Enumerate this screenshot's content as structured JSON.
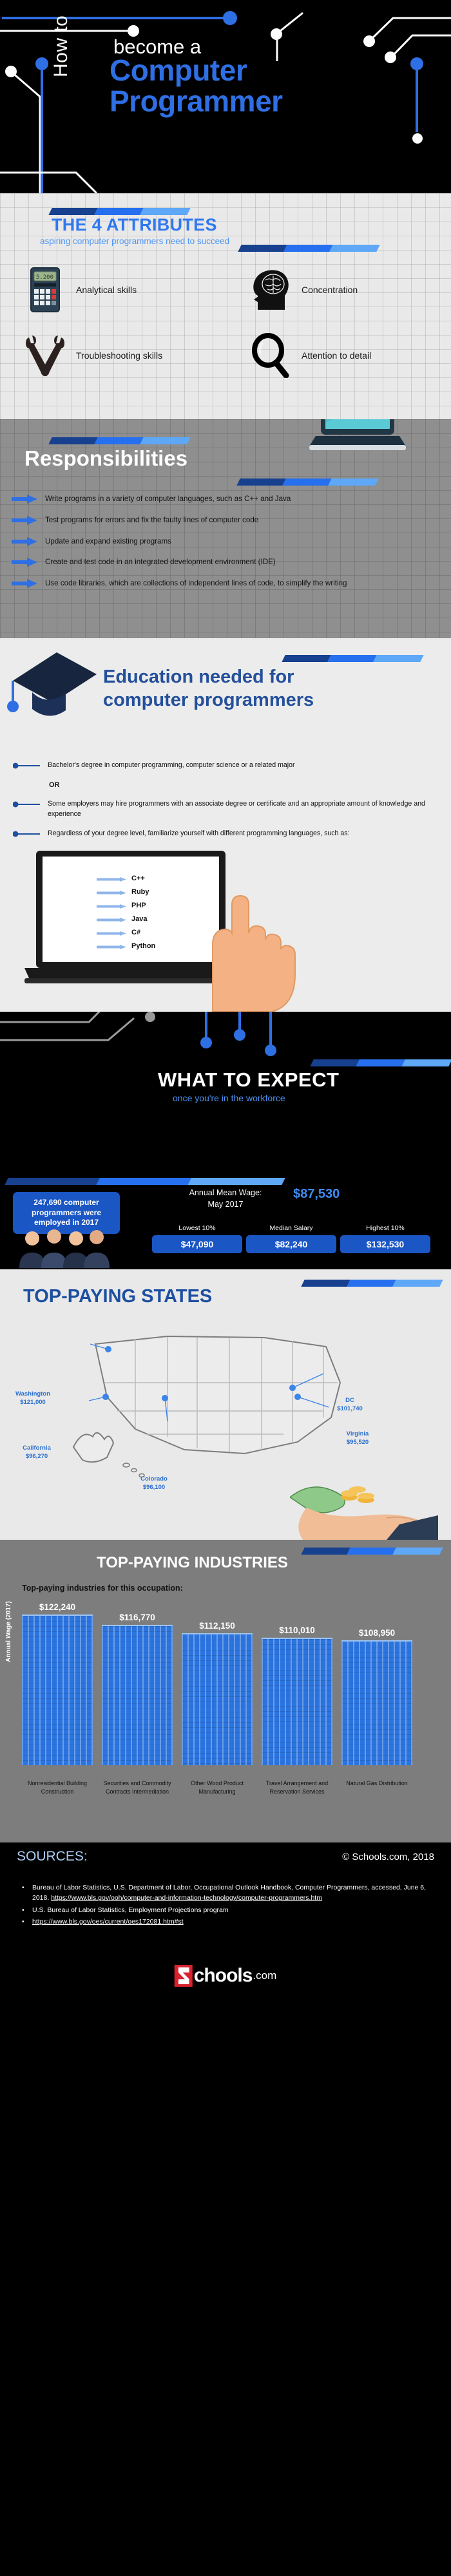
{
  "header": {
    "kicker_vertical": "How to",
    "kicker": "become a",
    "title_line1": "Computer",
    "title_line2": "Programmer"
  },
  "attributes": {
    "heading": "THE 4 ATTRIBUTES",
    "subheading": "aspiring computer programmers need to succeed",
    "items": [
      {
        "icon": "calculator-icon",
        "label": "Analytical skills"
      },
      {
        "icon": "brain-head-icon",
        "label": "Concentration"
      },
      {
        "icon": "crossed-wrenches-icon",
        "label": "Troubleshooting skills"
      },
      {
        "icon": "magnifying-glass-icon",
        "label": "Attention to detail"
      }
    ]
  },
  "responsibilities": {
    "heading": "Responsibilities",
    "items": [
      "Write programs in a variety of computer languages, such as C++ and Java",
      "Test programs for errors and fix the faulty lines of computer code",
      "Update and expand existing programs",
      "Create and test code in an integrated development environment (IDE)",
      "Use code libraries, which are collections of independent lines of code, to simplify the writing"
    ]
  },
  "education": {
    "heading_line1": "Education needed for",
    "heading_line2": "computer programmers",
    "items": [
      "Bachelor's degree in computer programming, computer science or a related major",
      "Some employers may hire programmers with an associate degree or certificate and an appropriate amount of knowledge and experience",
      "Regardless of your degree level, familiarize yourself with different programming languages, such as:"
    ],
    "or_word": "OR",
    "languages": [
      "C++",
      "Ruby",
      "PHP",
      "Java",
      "C#",
      "Python"
    ]
  },
  "what_to_expect": {
    "heading": "WHAT TO EXPECT",
    "subheading": "once you're in the workforce",
    "employment_stat": "247,690 computer programmers were employed in 2017",
    "annual_mean_wage_label": "Annual Mean Wage:",
    "annual_mean_wage_period": "May 2017",
    "annual_mean_wage_value": "$87,530",
    "wage_tiers": [
      {
        "label": "Lowest 10%",
        "value": "$47,090"
      },
      {
        "label": "Median Salary",
        "value": "$82,240"
      },
      {
        "label": "Highest 10%",
        "value": "$132,530"
      }
    ]
  },
  "top_paying_states": {
    "heading": "TOP-PAYING STATES",
    "states": [
      {
        "name": "Washington",
        "value": "$121,000"
      },
      {
        "name": "California",
        "value": "$96,270"
      },
      {
        "name": "Colorado",
        "value": "$96,100"
      },
      {
        "name": "Virginia",
        "value": "$95,520"
      },
      {
        "name": "DC",
        "value": "$101,740"
      }
    ]
  },
  "top_paying_industries": {
    "heading": "TOP-PAYING INDUSTRIES",
    "caption": "Top-paying industries for this occupation:",
    "y_axis_label": "Annual Wage (2017)"
  },
  "chart_data": {
    "type": "bar",
    "title": "TOP-PAYING INDUSTRIES",
    "subtitle": "Top-paying industries for this occupation:",
    "xlabel": "",
    "ylabel": "Annual Wage (2017)",
    "categories": [
      "Nonresidential Building Construction",
      "Securities and Commodity Contracts Intermediation",
      "Other Wood Product Manufacturing",
      "Travel Arrangement and Reservation Services",
      "Natural Gas Distribution"
    ],
    "values": [
      122240,
      116770,
      112150,
      110010,
      108950
    ],
    "value_labels": [
      "$122,240",
      "$116,770",
      "$112,150",
      "$110,010",
      "$108,950"
    ],
    "ylim": [
      0,
      130000
    ],
    "grid": false,
    "legend": "none",
    "bar_color": "#2b74e0"
  },
  "sources": {
    "heading": "SOURCES:",
    "copyright": "© Schools.com, 2018",
    "items": [
      {
        "text": "Bureau of Labor Statistics, U.S. Department of Labor, Occupational Outlook Handbook, Computer Programmers, accessed, June 6, 2018. ",
        "link": "https://www.bls.gov/ooh/computer-and-information-technology/computer-programmers.htm"
      },
      {
        "text": "U.S. Bureau of Labor Statistics, Employment Projections program",
        "link": ""
      },
      {
        "text": "",
        "link": "https://www.bls.gov/oes/current/oes172081.htm#st"
      }
    ],
    "logo_word": "chools",
    "logo_tld": ".com"
  },
  "colors": {
    "brand_blue": "#2f6fe4",
    "dark_blue": "#17418f",
    "light_blue": "#5ea8f7",
    "accent_red": "#d8232f"
  }
}
